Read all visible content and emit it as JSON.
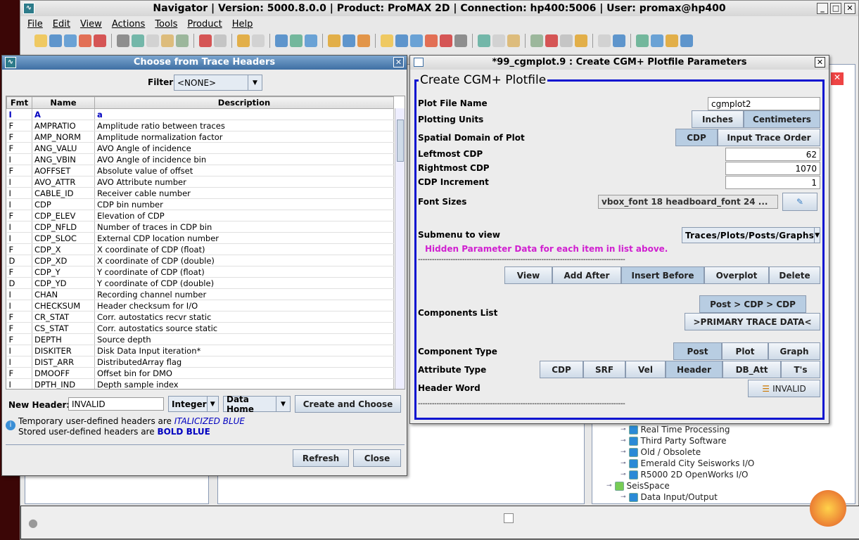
{
  "navigator": {
    "title": "Navigator | Version: 5000.8.0.0 | Product: ProMAX 2D | Connection: hp400:5006 | User: promax@hp400",
    "menu": [
      "File",
      "Edit",
      "View",
      "Actions",
      "Tools",
      "Product",
      "Help"
    ],
    "toolbar_icons": [
      "new-icon",
      "save-icon",
      "copy-window-icon",
      "refresh-red-icon",
      "close-red-icon",
      "|",
      "grid-icon",
      "cut-icon",
      "copy-icon",
      "paste-icon",
      "link-icon",
      "|",
      "stop-icon",
      "disabled-icon",
      "|",
      "comment-icon",
      "comment-disabled-icon",
      "|",
      "export-icon",
      "list-icon",
      "check-icon",
      "|",
      "run-icon",
      "run-box-icon",
      "cycle-icon",
      "|",
      "doc-icon",
      "table-icon",
      "chart-icon",
      "flow-icon",
      "globe-icon",
      "printer-icon",
      "|",
      "tree-icon",
      "gear-icon",
      "tools-icon",
      "|",
      "windows-icon",
      "window-icon",
      "disabled-icon2",
      "disabled-icon3",
      "|",
      "folder-icon",
      "printer2-icon",
      "|",
      "edit-icon",
      "edit2-icon",
      "settings-icon",
      "grid2-icon"
    ],
    "tree_items": [
      {
        "label": "Real Time Processing",
        "indent": 1
      },
      {
        "label": "Third Party Software",
        "indent": 1
      },
      {
        "label": "Old / Obsolete",
        "indent": 1
      },
      {
        "label": "Emerald City Seisworks I/O",
        "indent": 1
      },
      {
        "label": "R5000 2D OpenWorks I/O",
        "indent": 1
      },
      {
        "label": "SeisSpace",
        "indent": 0
      },
      {
        "label": "Data Input/Output",
        "indent": 1
      }
    ]
  },
  "trace_headers": {
    "title": "Choose from Trace Headers",
    "filter_label": "Filter",
    "filter_value": "<NONE>",
    "columns": [
      "Fmt",
      "Name",
      "Description"
    ],
    "rows": [
      [
        "I",
        "A",
        "a"
      ],
      [
        "F",
        "AMPRATIO",
        "Amplitude ratio between traces"
      ],
      [
        "F",
        "AMP_NORM",
        "Amplitude normalization factor"
      ],
      [
        "F",
        "ANG_VALU",
        "AVO Angle of incidence"
      ],
      [
        "I",
        "ANG_VBIN",
        "AVO Angle of incidence bin"
      ],
      [
        "F",
        "AOFFSET",
        "Absolute value of offset"
      ],
      [
        "I",
        "AVO_ATTR",
        "AVO Attribute number"
      ],
      [
        "I",
        "CABLE_ID",
        "Receiver cable number"
      ],
      [
        "I",
        "CDP",
        "CDP bin number"
      ],
      [
        "F",
        "CDP_ELEV",
        "Elevation of CDP"
      ],
      [
        "I",
        "CDP_NFLD",
        "Number of traces in CDP bin"
      ],
      [
        "I",
        "CDP_SLOC",
        "External CDP location number"
      ],
      [
        "F",
        "CDP_X",
        "X coordinate of CDP (float)"
      ],
      [
        "D",
        "CDP_XD",
        "X coordinate of CDP (double)"
      ],
      [
        "F",
        "CDP_Y",
        "Y coordinate of CDP (float)"
      ],
      [
        "D",
        "CDP_YD",
        "Y coordinate of CDP (double)"
      ],
      [
        "I",
        "CHAN",
        "Recording channel number"
      ],
      [
        "I",
        "CHECKSUM",
        "Header checksum for I/O"
      ],
      [
        "F",
        "CR_STAT",
        "Corr. autostatics recvr static"
      ],
      [
        "F",
        "CS_STAT",
        "Corr. autostatics source static"
      ],
      [
        "F",
        "DEPTH",
        "Source depth"
      ],
      [
        "I",
        "DISKITER",
        "Disk Data Input iteration*"
      ],
      [
        "I",
        "DIST_ARR",
        "DistributedArray flag"
      ],
      [
        "F",
        "DMOOFF",
        "Offset bin for DMO"
      ],
      [
        "I",
        "DPTH_IND",
        "Depth sample index"
      ]
    ],
    "new_header_label": "New Header:",
    "new_header_value": "INVALID",
    "type_value": "Integer",
    "home_value": "Data Home",
    "create_label": "Create and Choose",
    "info1_prefix": "Temporary user-defined headers are ",
    "info1_style": "ITALICIZED BLUE",
    "info2_prefix": "Stored user-defined headers are ",
    "info2_style": "BOLD BLUE",
    "refresh_label": "Refresh",
    "close_label": "Close"
  },
  "cgm": {
    "title": "*99_cgmplot.9 : Create CGM+ Plotfile Parameters",
    "group": "Create CGM+ Plotfile",
    "plot_file_label": "Plot File Name",
    "plot_file_value": "cgmplot2",
    "units_label": "Plotting Units",
    "units": [
      "Inches",
      "Centimeters"
    ],
    "units_selected": "Centimeters",
    "domain_label": "Spatial Domain of Plot",
    "domain": [
      "CDP",
      "Input Trace Order"
    ],
    "domain_selected": "CDP",
    "left_label": "Leftmost CDP",
    "left_value": "62",
    "right_label": "Rightmost CDP",
    "right_value": "1070",
    "inc_label": "CDP Increment",
    "inc_value": "1",
    "font_label": "Font Sizes",
    "font_value": "vbox_font  18 headboard_font 24 ...",
    "submenu_label": "Submenu to view",
    "submenu_value": "Traces/Plots/Posts/Graphs",
    "hidden_note": "Hidden Parameter Data for each item in list above.",
    "dashes": "-----------------------------------------------------------------------------------------",
    "actions": [
      "View",
      "Add After",
      "Insert Before",
      "Overplot",
      "Delete"
    ],
    "actions_selected": "Insert Before",
    "components_label": "Components List",
    "components": [
      "Post  > CDP > CDP",
      ">PRIMARY TRACE DATA<"
    ],
    "ctype_label": "Component Type",
    "ctypes": [
      "Post",
      "Plot",
      "Graph"
    ],
    "ctype_selected": "Post",
    "atype_label": "Attribute Type",
    "atypes": [
      "CDP",
      "SRF",
      "Vel",
      "Header",
      "DB_Att",
      "T's"
    ],
    "atype_selected": "Header",
    "hword_label": "Header Word",
    "hword_value": "INVALID"
  }
}
